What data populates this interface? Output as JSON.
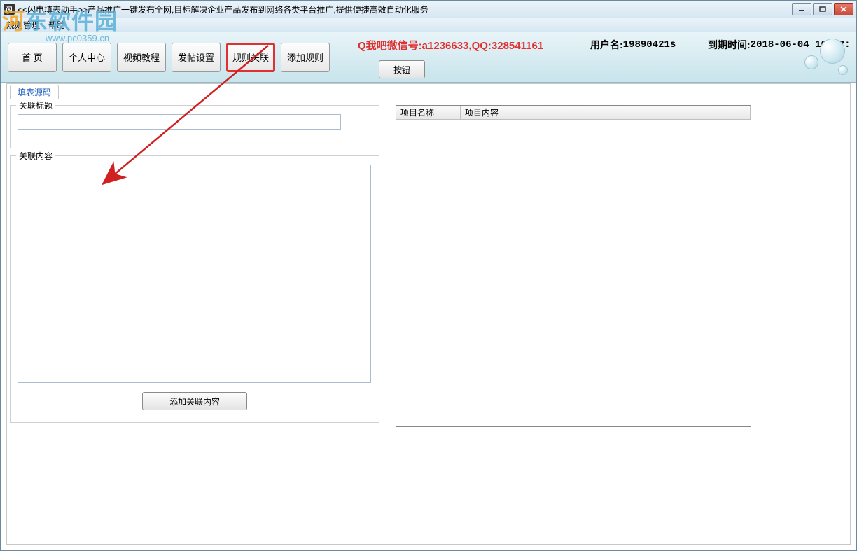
{
  "window": {
    "title": "<<闪电填表助手>>产品推广一键发布全网,目标解决企业产品发布到网络各类平台推广,提供便捷高效自动化服务"
  },
  "menu": {
    "item1": "规则管理",
    "item2": "帮助"
  },
  "watermark": {
    "text_part1": "河",
    "text_part2": "东软件园",
    "url": "www.pc0359.cn"
  },
  "toolbar": {
    "home": "首 页",
    "user_center": "个人中心",
    "video": "视频教程",
    "post_settings": "发帖设置",
    "rule_assoc": "规则关联",
    "add_rule": "添加规则",
    "sub_button": "按钮"
  },
  "info": {
    "promo": "Q我吧微信号:a1236633,QQ:328541161",
    "user_label": "用户名: ",
    "user_value": "19890421s",
    "expire_label": "到期时间: ",
    "expire_value": "2018-06-04 10:12:"
  },
  "tabs": {
    "form_source": "填表源码"
  },
  "form": {
    "assoc_title_label": "关联标题",
    "assoc_title_value": "",
    "assoc_content_label": "关联内容",
    "assoc_content_value": "",
    "add_assoc_button": "添加关联内容"
  },
  "table": {
    "col_name": "项目名称",
    "col_content": "项目内容"
  }
}
